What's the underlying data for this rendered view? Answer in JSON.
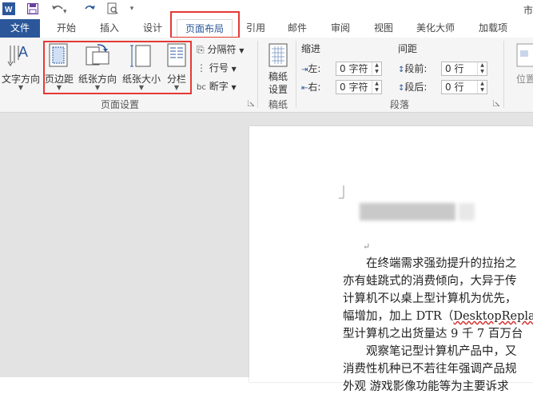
{
  "title_bar": {
    "title_partial": "市"
  },
  "tabs": [
    {
      "label": "文件"
    },
    {
      "label": "开始"
    },
    {
      "label": "插入"
    },
    {
      "label": "设计"
    },
    {
      "label": "页面布局"
    },
    {
      "label": "引用"
    },
    {
      "label": "邮件"
    },
    {
      "label": "审阅"
    },
    {
      "label": "视图"
    },
    {
      "label": "美化大师"
    },
    {
      "label": "加载项"
    }
  ],
  "ribbon": {
    "text_direction": "文字方向",
    "margins": "页边距",
    "orientation": "纸张方向",
    "size": "纸张大小",
    "columns": "分栏",
    "breaks": "分隔符",
    "line_numbers": "行号",
    "hyphenation": "断字",
    "page_setup_label": "页面设置",
    "manuscript_btn_line1": "稿纸",
    "manuscript_btn_line2": "设置",
    "manuscript_label": "稿纸",
    "indent_header": "缩进",
    "spacing_header": "间距",
    "indent_left_label": "左:",
    "indent_left_value": "0 字符",
    "indent_right_label": "右:",
    "indent_right_value": "0 字符",
    "spacing_before_label": "段前:",
    "spacing_before_value": "0 行",
    "spacing_after_label": "段后:",
    "spacing_after_value": "0 行",
    "paragraph_label": "段落",
    "position_partial": "位置"
  },
  "document": {
    "paragraph_mark": "↵",
    "lines": [
      "　　在终端需求强劲提升的拉抬之",
      "亦有蛙跳式的消费倾向，大异于传",
      "计算机不以桌上型计算机为优先，",
      "幅增加，加上 DTR（",
      "型计算机之出货量达 9 千 7 百万台",
      "　　观察笔记型计算机产品中，又",
      "消费性机种已不若往年强调产品规",
      "外观 游戏影像功能等为主要诉求"
    ],
    "dtr_word": "DesktopReplac"
  },
  "colors": {
    "file_tab": "#2b579a",
    "active_tab_text": "#2b579a",
    "highlight": "#e53935"
  }
}
